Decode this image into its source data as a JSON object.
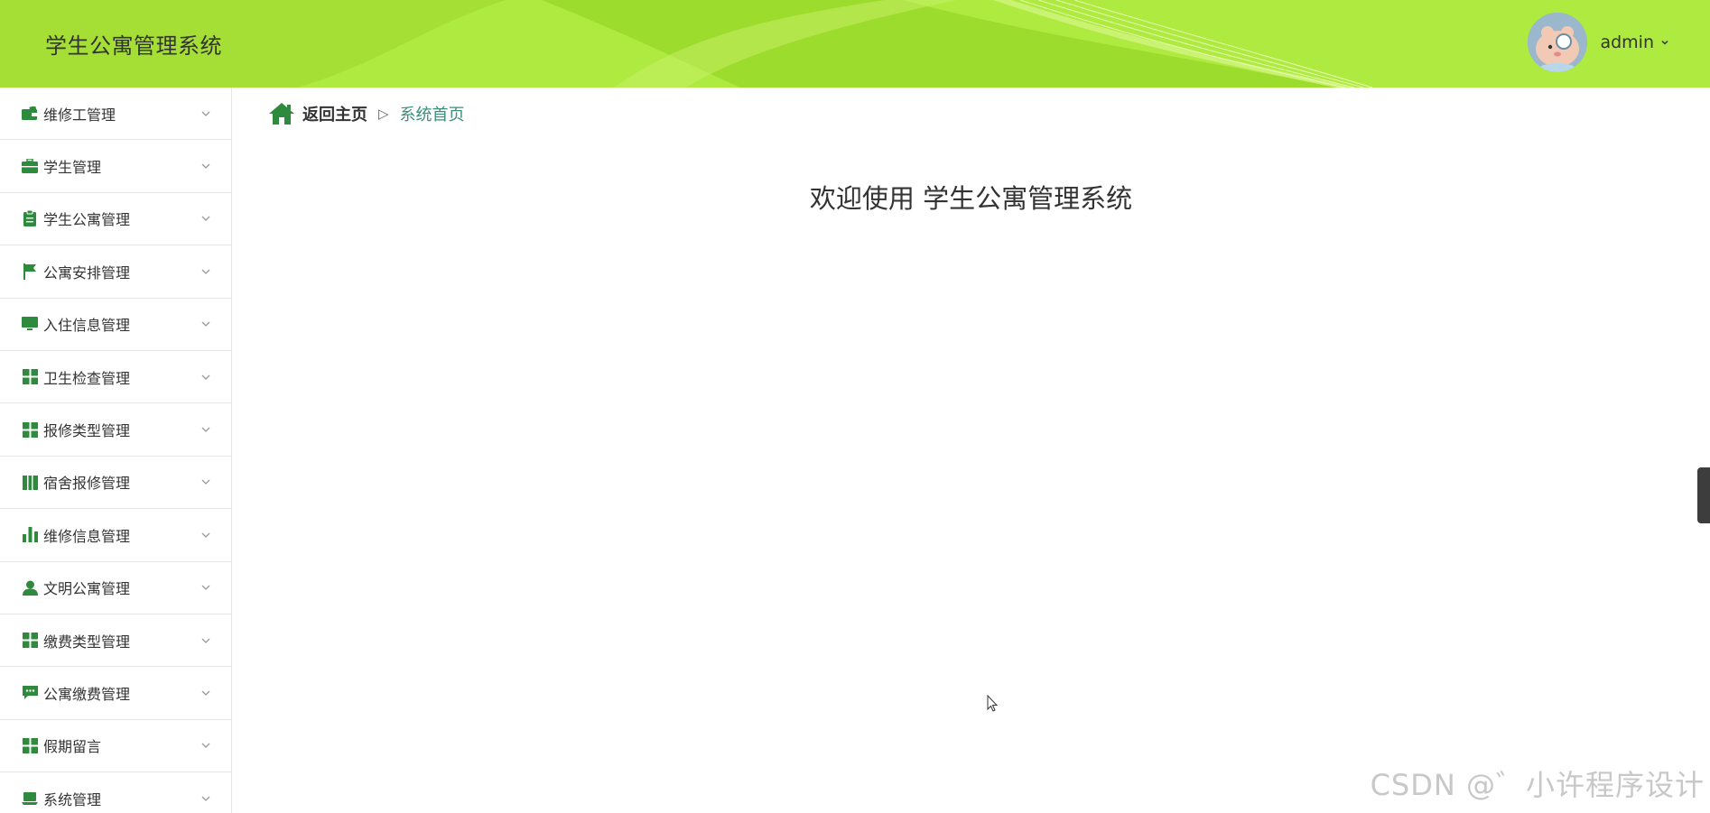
{
  "header": {
    "title": "学生公寓管理系统",
    "username": "admin",
    "background_color": "#aeea3f"
  },
  "sidebar": {
    "accent_color": "#2e8b3d",
    "items": [
      {
        "label": "维修工管理",
        "icon": "wallet-icon"
      },
      {
        "label": "学生管理",
        "icon": "briefcase-icon"
      },
      {
        "label": "学生公寓管理",
        "icon": "clipboard-icon"
      },
      {
        "label": "公寓安排管理",
        "icon": "flag-icon"
      },
      {
        "label": "入住信息管理",
        "icon": "monitor-icon"
      },
      {
        "label": "卫生检查管理",
        "icon": "grid-icon"
      },
      {
        "label": "报修类型管理",
        "icon": "grid-icon"
      },
      {
        "label": "宿舍报修管理",
        "icon": "book-icon"
      },
      {
        "label": "维修信息管理",
        "icon": "bar-chart-icon"
      },
      {
        "label": "文明公寓管理",
        "icon": "user-icon"
      },
      {
        "label": "缴费类型管理",
        "icon": "grid-icon"
      },
      {
        "label": "公寓缴费管理",
        "icon": "message-icon"
      },
      {
        "label": "假期留言",
        "icon": "grid-icon"
      },
      {
        "label": "系统管理",
        "icon": "laptop-icon"
      }
    ]
  },
  "breadcrumb": {
    "home": "返回主页",
    "current": "系统首页"
  },
  "main": {
    "welcome": "欢迎使用 学生公寓管理系统"
  },
  "watermark": "CSDN @゛小许程序设计"
}
